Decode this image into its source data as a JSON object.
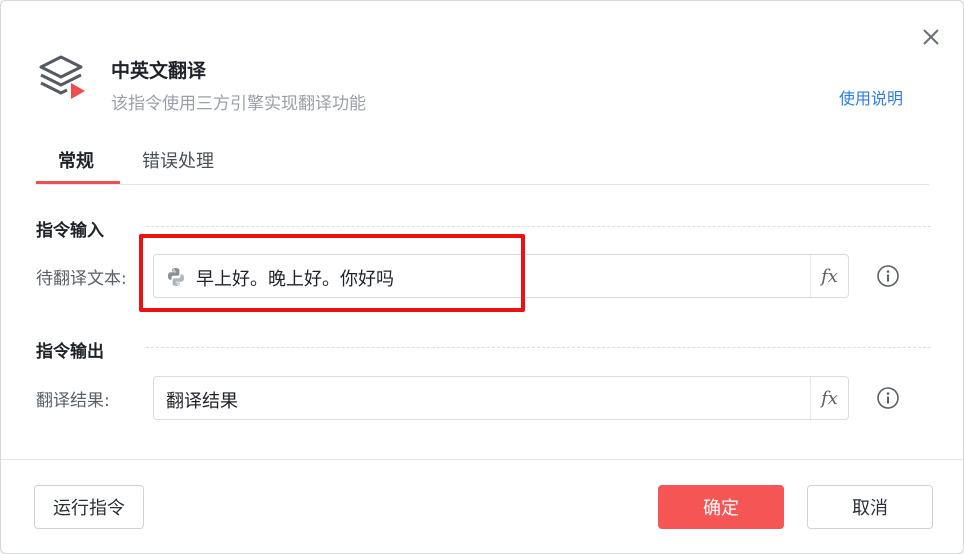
{
  "header": {
    "title": "中英文翻译",
    "subtitle": "该指令使用三方引擎实现翻译功能",
    "help_link": "使用说明",
    "icon": "layers-play-icon",
    "accent_color": "#f04e4e"
  },
  "tabs": [
    {
      "label": "常规",
      "active": true
    },
    {
      "label": "错误处理",
      "active": false
    }
  ],
  "input_section": {
    "title": "指令输入",
    "fields": [
      {
        "label": "待翻译文本:",
        "value": "早上好。晚上好。你好吗",
        "icon": "python-icon",
        "fx": "fx"
      }
    ]
  },
  "output_section": {
    "title": "指令输出",
    "fields": [
      {
        "label": "翻译结果:",
        "value": "翻译结果",
        "fx": "fx"
      }
    ]
  },
  "footer": {
    "run_button": "运行指令",
    "confirm_button": "确定",
    "cancel_button": "取消"
  }
}
